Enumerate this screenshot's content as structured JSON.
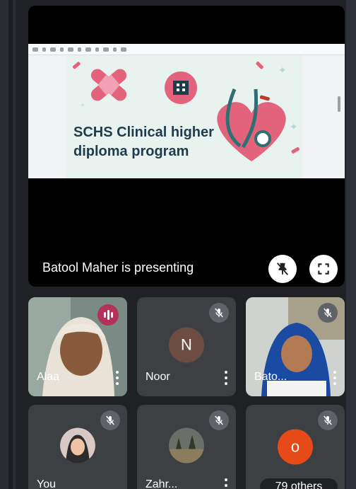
{
  "presentation": {
    "slide_title_line1": "SCHS Clinical higher",
    "slide_title_line2": "diploma  program",
    "presenting_text": "Batool Maher is presenting"
  },
  "participants": [
    {
      "name": "Alaa",
      "state": "speaking"
    },
    {
      "name": "Noor",
      "initial": "N",
      "avatar_color": "#6d4c41",
      "state": "muted"
    },
    {
      "name": "Bato...",
      "state": "muted"
    },
    {
      "name": "You",
      "state": "muted"
    },
    {
      "name": "Zahr...",
      "state": "muted"
    },
    {
      "initial": "o",
      "avatar_color": "#e64a19",
      "others_label": "79 others",
      "state": "muted"
    }
  ],
  "icons": {
    "speaking": "audio-level-icon",
    "muted": "mic-off-icon",
    "pin": "pin-off-icon",
    "fullscreen": "fullscreen-icon",
    "menu": "more-vert-icon"
  },
  "colors": {
    "tile_bg": "#3c4043",
    "speaking_badge": "#b3325a",
    "slide_title": "#1f3b4d"
  }
}
